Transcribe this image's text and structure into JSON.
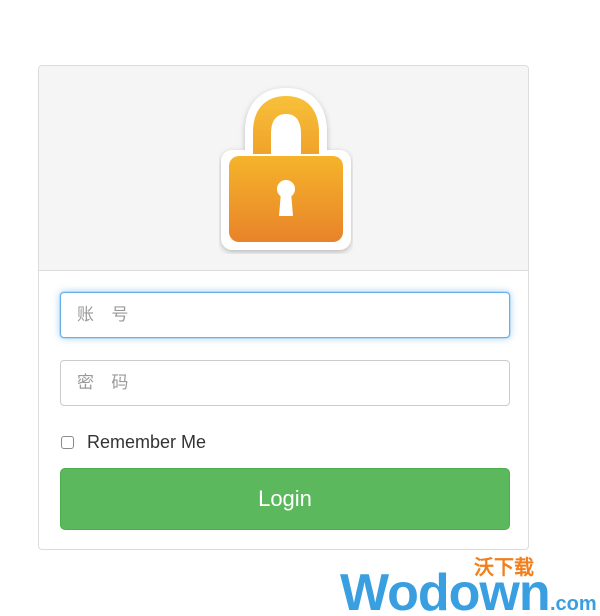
{
  "login_form": {
    "account_placeholder": "账 号",
    "password_placeholder": "密 码",
    "remember_label": "Remember Me",
    "login_label": "Login"
  },
  "watermark": {
    "brand_text": "Wodown",
    "domain_suffix": ".com",
    "cn_text": "沃下载"
  },
  "colors": {
    "panel_heading_bg": "#f5f5f5",
    "lock_top": "#f5b42a",
    "lock_bottom": "#e8832a",
    "button_green": "#5cb85c",
    "focus_blue": "#66afe9",
    "watermark_blue": "#3a9fe0",
    "watermark_orange": "#f07f1e"
  },
  "icons": {
    "header_icon": "padlock-icon"
  }
}
